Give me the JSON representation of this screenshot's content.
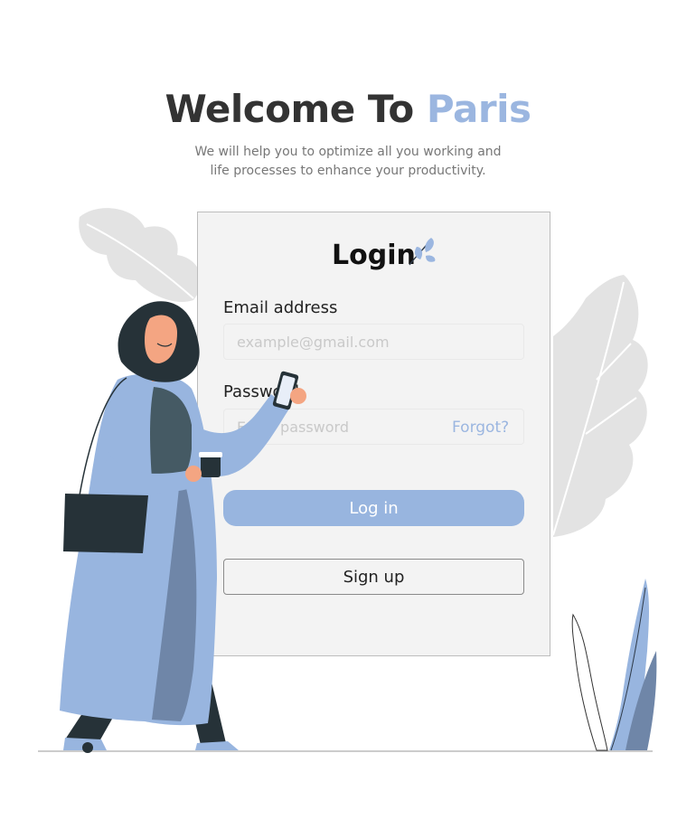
{
  "header": {
    "title_main": "Welcome To",
    "title_accent": "Paris",
    "subtitle_line1": "We will help you to optimize all you working and",
    "subtitle_line2": "life processes to enhance your productivity."
  },
  "login_card": {
    "title": "Login",
    "email_label": "Email address",
    "email_placeholder": "example@gmail.com",
    "password_label": "Password",
    "password_placeholder": "Enter password",
    "forgot_link": "Forgot?",
    "login_button": "Log in",
    "signup_button": "Sign up"
  },
  "colors": {
    "accent": "#9bb6e0",
    "button": "#98b5df",
    "card_bg": "#f3f3f3",
    "heading": "#333333"
  },
  "icons": [
    "leaf-icon"
  ]
}
